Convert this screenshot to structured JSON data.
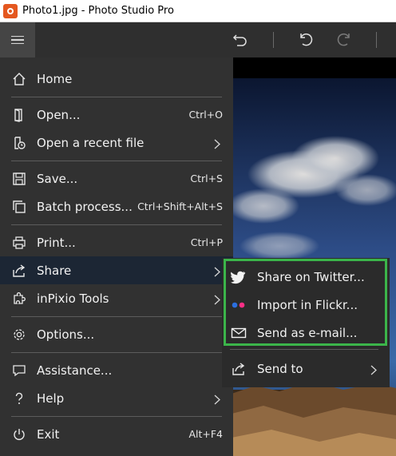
{
  "window": {
    "title": "Photo1.jpg - Photo Studio Pro"
  },
  "toolbar": {
    "menu_icon": "hamburger-icon",
    "icons": [
      "undo-all-icon",
      "undo-icon",
      "redo-icon"
    ]
  },
  "menu": {
    "home": {
      "label": "Home",
      "icon": "home-icon"
    },
    "open": {
      "label": "Open...",
      "shortcut": "Ctrl+O",
      "icon": "open-file-icon"
    },
    "open_recent": {
      "label": "Open a recent file",
      "icon": "recent-file-icon"
    },
    "save": {
      "label": "Save...",
      "shortcut": "Ctrl+S",
      "icon": "save-icon"
    },
    "batch": {
      "label": "Batch process...",
      "shortcut": "Ctrl+Shift+Alt+S",
      "icon": "batch-icon"
    },
    "print": {
      "label": "Print...",
      "shortcut": "Ctrl+P",
      "icon": "print-icon"
    },
    "share": {
      "label": "Share",
      "icon": "share-icon"
    },
    "tools": {
      "label": "inPixio Tools",
      "icon": "puzzle-icon"
    },
    "options": {
      "label": "Options...",
      "icon": "gear-icon"
    },
    "assistance": {
      "label": "Assistance...",
      "icon": "chat-icon"
    },
    "help": {
      "label": "Help",
      "icon": "question-icon"
    },
    "exit": {
      "label": "Exit",
      "shortcut": "Alt+F4",
      "icon": "power-icon"
    }
  },
  "share_submenu": {
    "twitter": {
      "label": "Share on Twitter...",
      "icon": "twitter-icon"
    },
    "flickr": {
      "label": "Import in Flickr...",
      "icon": "flickr-icon"
    },
    "email": {
      "label": "Send as e-mail...",
      "icon": "mail-icon"
    },
    "send_to": {
      "label": "Send to",
      "icon": "share-icon"
    }
  },
  "colors": {
    "highlight_border": "#3bb54a",
    "menu_bg": "#313131",
    "active_item": "#1c2634",
    "app_accent": "#e4571f"
  }
}
